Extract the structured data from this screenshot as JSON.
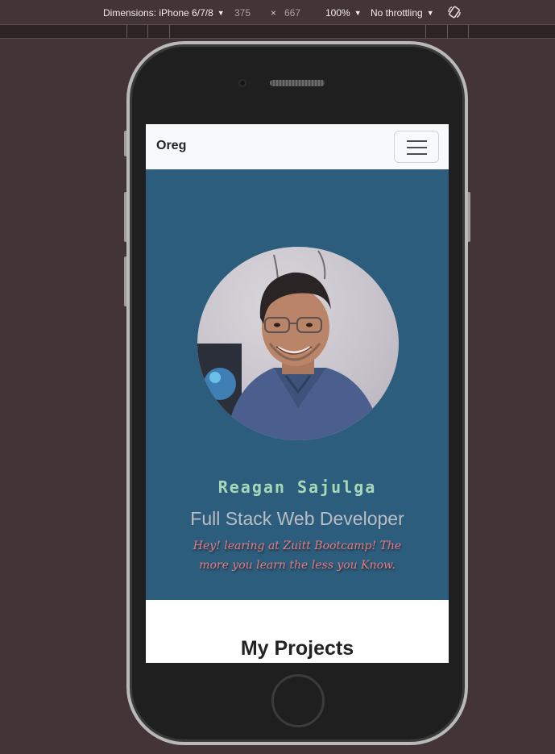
{
  "devtools": {
    "dimensions_label": "Dimensions: iPhone 6/7/8",
    "width": "375",
    "times": "×",
    "height": "667",
    "zoom": "100%",
    "throttling": "No throttling",
    "caret": "▼",
    "rotate_icon": "rotate-icon"
  },
  "site": {
    "brand": "Oreg",
    "menu_icon": "hamburger-icon",
    "hero": {
      "name": "Reagan Sajulga",
      "title": "Full Stack Web Developer",
      "tagline": "Hey! learing at Zuitt Bootcamp! The more you learn the less you Know."
    },
    "section_title": "My Projects"
  },
  "colors": {
    "page_bg": "#433437",
    "navbar_bg": "#f8f9fa",
    "hero_bg": "#2d5d7c",
    "name_color": "#a8d8b9",
    "title_color": "#b8bec4",
    "tagline_color": "#e8797f"
  }
}
